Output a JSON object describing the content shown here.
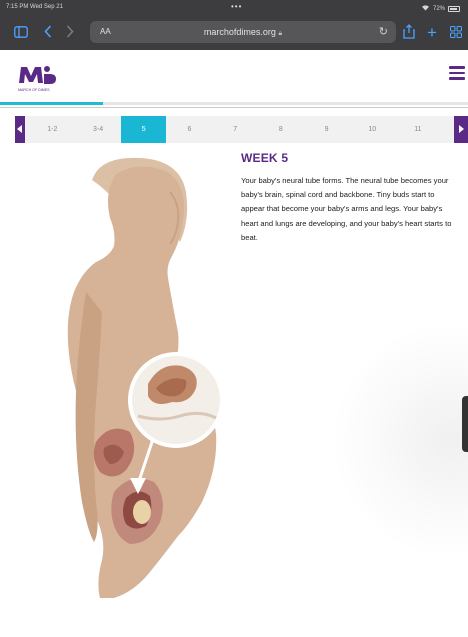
{
  "status_bar": {
    "time": "7:15 PM  Wed Sep 21",
    "battery": "72%"
  },
  "browser": {
    "reader_label": "AA",
    "url": "marchofdimes.org"
  },
  "site": {
    "logo_text": "MARCH OF DIMES",
    "brand_color": "#5b2a86",
    "accent_color": "#1ab7d4"
  },
  "week_nav": {
    "items": [
      "1-2",
      "3-4",
      "5",
      "6",
      "7",
      "8",
      "9",
      "10",
      "11"
    ],
    "active": "5",
    "progress_fraction": 0.22
  },
  "content": {
    "title": "WEEK 5",
    "description": "Your baby's neural tube forms. The neural tube becomes your baby's brain, spinal cord and backbone. Tiny buds start to appear that become your baby's arms and legs. Your baby's heart and lungs are developing, and your baby's heart starts to beat."
  },
  "icons": {
    "sidebar": "sidebar-icon",
    "back": "back-icon",
    "forward": "forward-icon",
    "reload": "reload-icon",
    "share": "share-icon",
    "new_tab": "plus-icon",
    "tabs": "tabs-grid-icon"
  }
}
